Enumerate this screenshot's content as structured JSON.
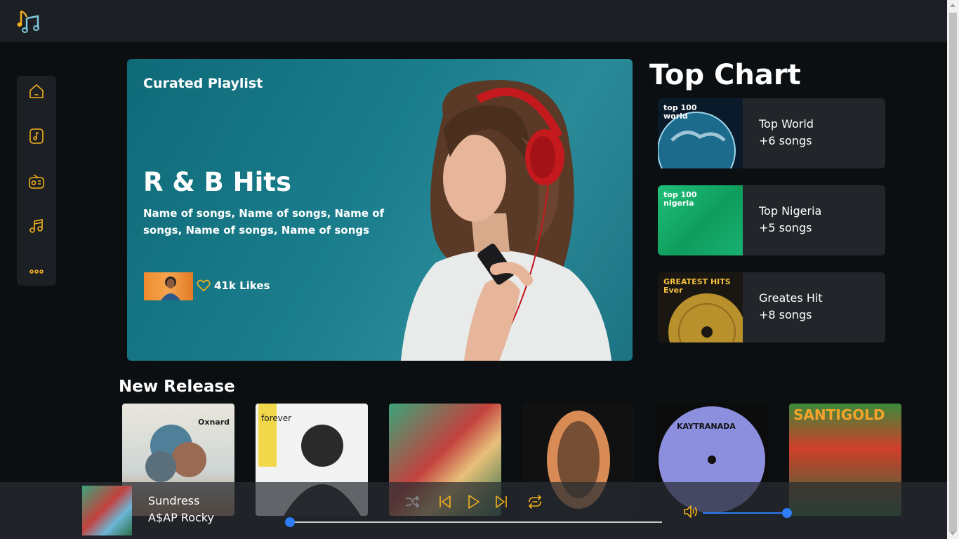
{
  "colors": {
    "accent": "#f5b01a",
    "background": "#0b0f12",
    "panel": "#1c2024",
    "card": "#22262a",
    "slider": "#2e7cf6"
  },
  "header": {
    "logo_icon": "music-notes-icon"
  },
  "sidebar": {
    "items": [
      {
        "name": "home",
        "icon": "home-icon"
      },
      {
        "name": "music-library",
        "icon": "music-file-icon"
      },
      {
        "name": "radio",
        "icon": "radio-icon"
      },
      {
        "name": "music",
        "icon": "music-note-icon"
      },
      {
        "name": "more",
        "icon": "more-dots-icon"
      }
    ]
  },
  "hero": {
    "label": "Curated Playlist",
    "title": "R & B Hits",
    "songs": "Name of songs, Name of songs, Name of songs, Name of songs, Name of songs",
    "likes": "41k Likes"
  },
  "top_chart": {
    "title": "Top Chart",
    "items": [
      {
        "name": "Top World",
        "count": "+6 songs",
        "art_text": "top 100 world"
      },
      {
        "name": "Top Nigeria",
        "count": "+5 songs",
        "art_text": "top 100 nigeria"
      },
      {
        "name": "Greates Hit",
        "count": "+8 songs",
        "art_text": "GREATEST HITS Ever"
      }
    ]
  },
  "new_release": {
    "title": "New Release",
    "albums": [
      {
        "art_text": "Oxnard"
      },
      {
        "art_text": "forever"
      },
      {
        "art_text": ""
      },
      {
        "art_text": ""
      },
      {
        "art_text": "KAYTRANADA"
      },
      {
        "art_text": "SANTIGOLD"
      }
    ]
  },
  "player": {
    "title": "Sundress",
    "artist": "A$AP Rocky",
    "progress": 0.0,
    "volume": 1.0
  }
}
